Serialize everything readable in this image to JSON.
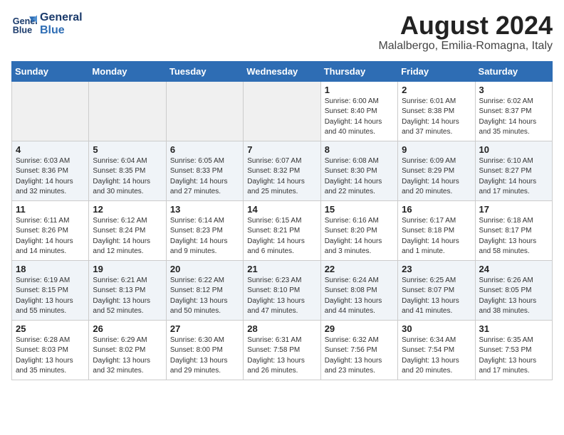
{
  "header": {
    "logo_line1": "General",
    "logo_line2": "Blue",
    "month_year": "August 2024",
    "location": "Malalbergo, Emilia-Romagna, Italy"
  },
  "days_of_week": [
    "Sunday",
    "Monday",
    "Tuesday",
    "Wednesday",
    "Thursday",
    "Friday",
    "Saturday"
  ],
  "weeks": [
    [
      {
        "day": "",
        "info": ""
      },
      {
        "day": "",
        "info": ""
      },
      {
        "day": "",
        "info": ""
      },
      {
        "day": "",
        "info": ""
      },
      {
        "day": "1",
        "info": "Sunrise: 6:00 AM\nSunset: 8:40 PM\nDaylight: 14 hours\nand 40 minutes."
      },
      {
        "day": "2",
        "info": "Sunrise: 6:01 AM\nSunset: 8:38 PM\nDaylight: 14 hours\nand 37 minutes."
      },
      {
        "day": "3",
        "info": "Sunrise: 6:02 AM\nSunset: 8:37 PM\nDaylight: 14 hours\nand 35 minutes."
      }
    ],
    [
      {
        "day": "4",
        "info": "Sunrise: 6:03 AM\nSunset: 8:36 PM\nDaylight: 14 hours\nand 32 minutes."
      },
      {
        "day": "5",
        "info": "Sunrise: 6:04 AM\nSunset: 8:35 PM\nDaylight: 14 hours\nand 30 minutes."
      },
      {
        "day": "6",
        "info": "Sunrise: 6:05 AM\nSunset: 8:33 PM\nDaylight: 14 hours\nand 27 minutes."
      },
      {
        "day": "7",
        "info": "Sunrise: 6:07 AM\nSunset: 8:32 PM\nDaylight: 14 hours\nand 25 minutes."
      },
      {
        "day": "8",
        "info": "Sunrise: 6:08 AM\nSunset: 8:30 PM\nDaylight: 14 hours\nand 22 minutes."
      },
      {
        "day": "9",
        "info": "Sunrise: 6:09 AM\nSunset: 8:29 PM\nDaylight: 14 hours\nand 20 minutes."
      },
      {
        "day": "10",
        "info": "Sunrise: 6:10 AM\nSunset: 8:27 PM\nDaylight: 14 hours\nand 17 minutes."
      }
    ],
    [
      {
        "day": "11",
        "info": "Sunrise: 6:11 AM\nSunset: 8:26 PM\nDaylight: 14 hours\nand 14 minutes."
      },
      {
        "day": "12",
        "info": "Sunrise: 6:12 AM\nSunset: 8:24 PM\nDaylight: 14 hours\nand 12 minutes."
      },
      {
        "day": "13",
        "info": "Sunrise: 6:14 AM\nSunset: 8:23 PM\nDaylight: 14 hours\nand 9 minutes."
      },
      {
        "day": "14",
        "info": "Sunrise: 6:15 AM\nSunset: 8:21 PM\nDaylight: 14 hours\nand 6 minutes."
      },
      {
        "day": "15",
        "info": "Sunrise: 6:16 AM\nSunset: 8:20 PM\nDaylight: 14 hours\nand 3 minutes."
      },
      {
        "day": "16",
        "info": "Sunrise: 6:17 AM\nSunset: 8:18 PM\nDaylight: 14 hours\nand 1 minute."
      },
      {
        "day": "17",
        "info": "Sunrise: 6:18 AM\nSunset: 8:17 PM\nDaylight: 13 hours\nand 58 minutes."
      }
    ],
    [
      {
        "day": "18",
        "info": "Sunrise: 6:19 AM\nSunset: 8:15 PM\nDaylight: 13 hours\nand 55 minutes."
      },
      {
        "day": "19",
        "info": "Sunrise: 6:21 AM\nSunset: 8:13 PM\nDaylight: 13 hours\nand 52 minutes."
      },
      {
        "day": "20",
        "info": "Sunrise: 6:22 AM\nSunset: 8:12 PM\nDaylight: 13 hours\nand 50 minutes."
      },
      {
        "day": "21",
        "info": "Sunrise: 6:23 AM\nSunset: 8:10 PM\nDaylight: 13 hours\nand 47 minutes."
      },
      {
        "day": "22",
        "info": "Sunrise: 6:24 AM\nSunset: 8:08 PM\nDaylight: 13 hours\nand 44 minutes."
      },
      {
        "day": "23",
        "info": "Sunrise: 6:25 AM\nSunset: 8:07 PM\nDaylight: 13 hours\nand 41 minutes."
      },
      {
        "day": "24",
        "info": "Sunrise: 6:26 AM\nSunset: 8:05 PM\nDaylight: 13 hours\nand 38 minutes."
      }
    ],
    [
      {
        "day": "25",
        "info": "Sunrise: 6:28 AM\nSunset: 8:03 PM\nDaylight: 13 hours\nand 35 minutes."
      },
      {
        "day": "26",
        "info": "Sunrise: 6:29 AM\nSunset: 8:02 PM\nDaylight: 13 hours\nand 32 minutes."
      },
      {
        "day": "27",
        "info": "Sunrise: 6:30 AM\nSunset: 8:00 PM\nDaylight: 13 hours\nand 29 minutes."
      },
      {
        "day": "28",
        "info": "Sunrise: 6:31 AM\nSunset: 7:58 PM\nDaylight: 13 hours\nand 26 minutes."
      },
      {
        "day": "29",
        "info": "Sunrise: 6:32 AM\nSunset: 7:56 PM\nDaylight: 13 hours\nand 23 minutes."
      },
      {
        "day": "30",
        "info": "Sunrise: 6:34 AM\nSunset: 7:54 PM\nDaylight: 13 hours\nand 20 minutes."
      },
      {
        "day": "31",
        "info": "Sunrise: 6:35 AM\nSunset: 7:53 PM\nDaylight: 13 hours\nand 17 minutes."
      }
    ]
  ]
}
